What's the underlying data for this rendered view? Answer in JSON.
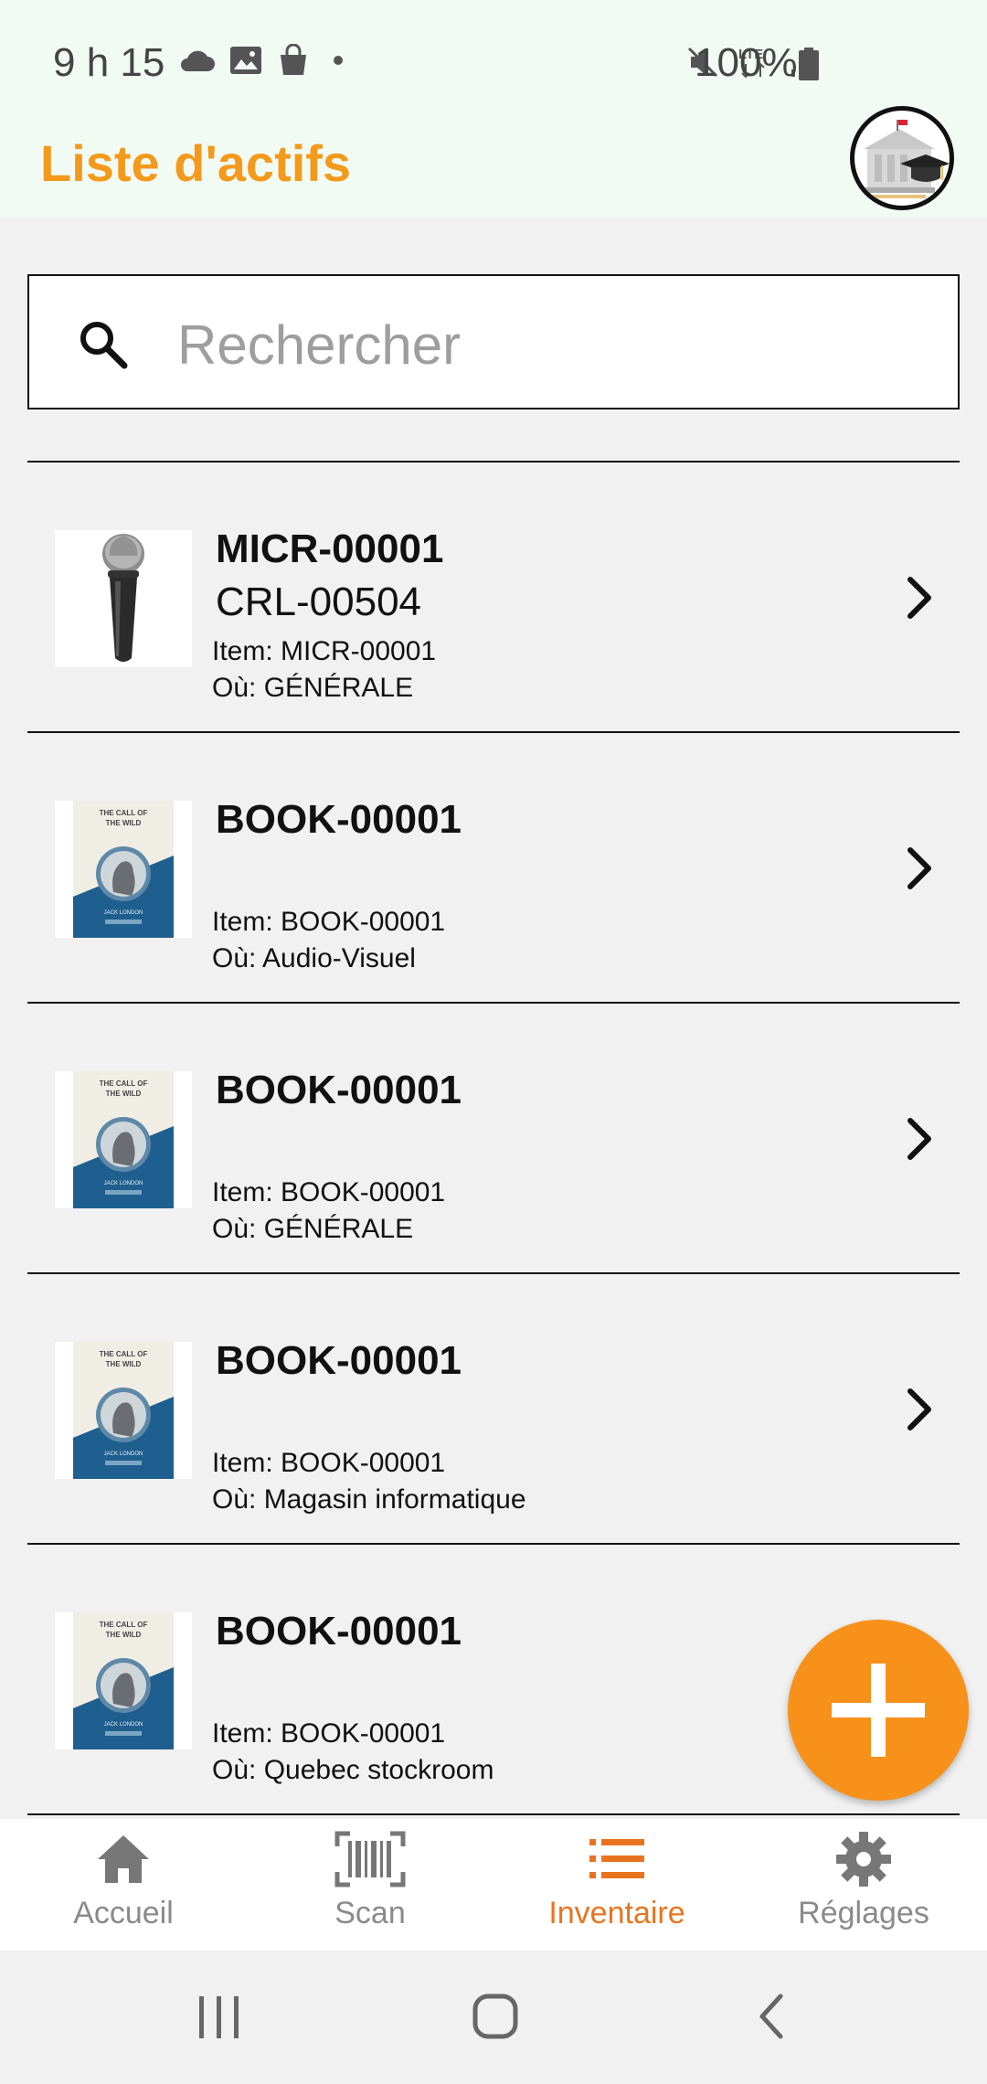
{
  "status_bar": {
    "time": "9 h 15",
    "battery": "100%",
    "network": "LTE"
  },
  "header": {
    "title": "Liste d'actifs"
  },
  "search": {
    "placeholder": "Rechercher",
    "value": ""
  },
  "items": [
    {
      "code": "MICR-00001",
      "sub": "CRL-00504",
      "item_label": "Item: MICR-00001",
      "location_label": "Où: GÉNÉRALE",
      "thumbnail": "microphone"
    },
    {
      "code": "BOOK-00001",
      "sub": "",
      "item_label": "Item: BOOK-00001",
      "location_label": "Où: Audio-Visuel",
      "thumbnail": "book-cover"
    },
    {
      "code": "BOOK-00001",
      "sub": "",
      "item_label": "Item: BOOK-00001",
      "location_label": "Où: GÉNÉRALE",
      "thumbnail": "book-cover"
    },
    {
      "code": "BOOK-00001",
      "sub": "",
      "item_label": "Item: BOOK-00001",
      "location_label": "Où: Magasin informatique",
      "thumbnail": "book-cover"
    },
    {
      "code": "BOOK-00001",
      "sub": "",
      "item_label": "Item: BOOK-00001",
      "location_label": "Où: Quebec stockroom",
      "thumbnail": "book-cover"
    }
  ],
  "book_cover_text": {
    "title_line1": "THE CALL OF",
    "title_line2": "THE WILD",
    "author": "JACK LONDON"
  },
  "nav": {
    "items": [
      {
        "label": "Accueil",
        "icon": "home-icon",
        "active": false
      },
      {
        "label": "Scan",
        "icon": "barcode-scan-icon",
        "active": false
      },
      {
        "label": "Inventaire",
        "icon": "list-icon",
        "active": true
      },
      {
        "label": "Réglages",
        "icon": "gear-icon",
        "active": false
      }
    ]
  },
  "colors": {
    "accent": "#f39a1c",
    "fab": "#f7911a",
    "active_nav": "#e9741f",
    "header_bg": "#f1fbf4",
    "page_bg": "#f1f1f1"
  }
}
